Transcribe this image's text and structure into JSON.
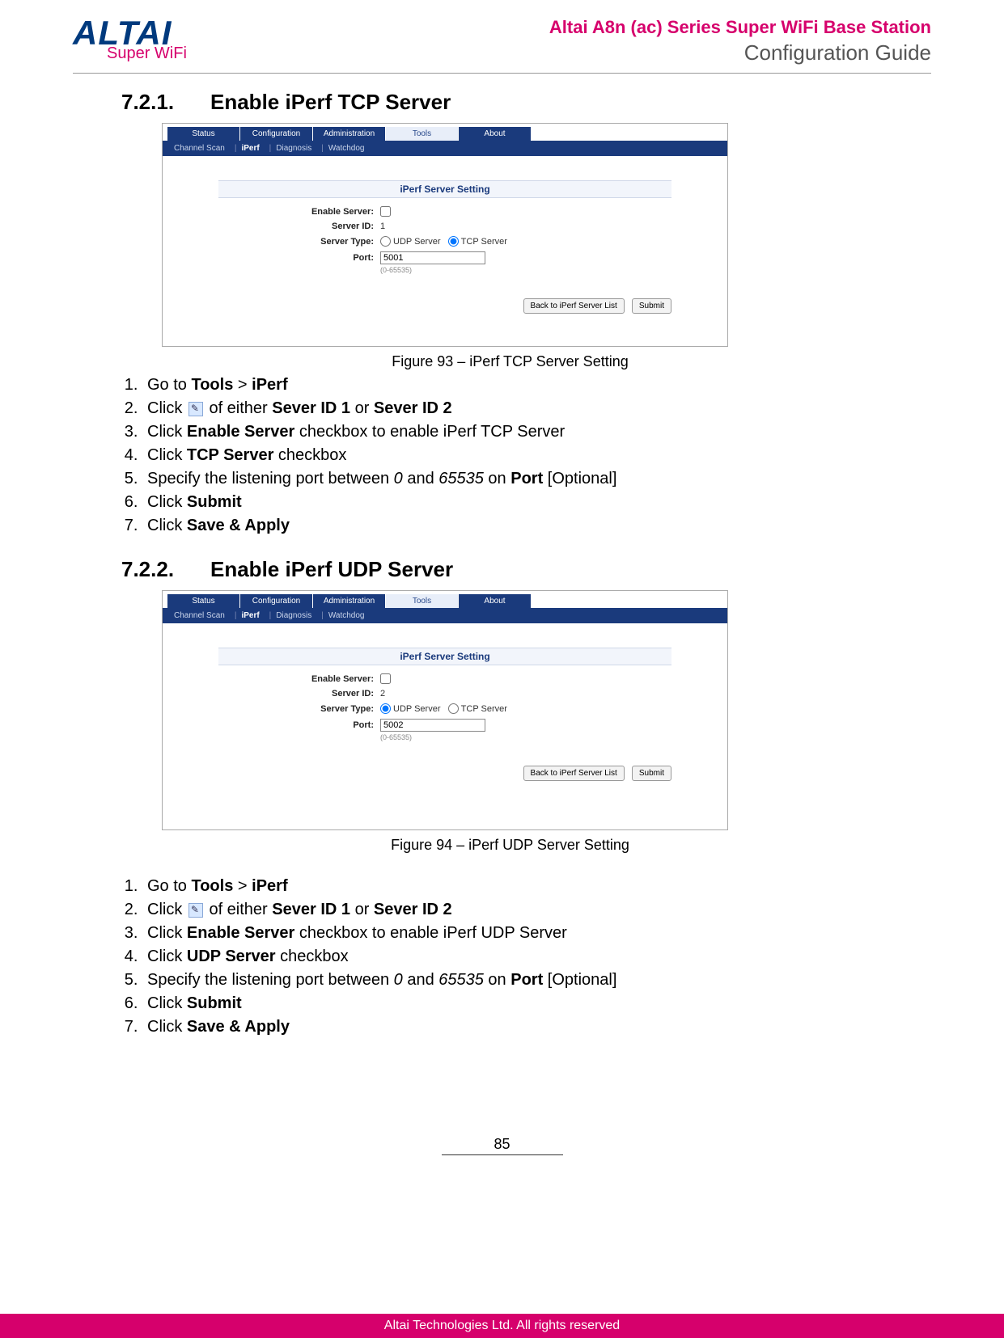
{
  "header": {
    "logo_main": "ALTAI",
    "logo_sub": "Super WiFi",
    "line1": "Altai A8n (ac) Series Super WiFi Base Station",
    "line2": "Configuration Guide"
  },
  "section1": {
    "number": "7.2.1.",
    "title": "Enable iPerf TCP Server",
    "figure_caption": "Figure 93 – iPerf TCP Server Setting",
    "ui": {
      "tabs": [
        "Status",
        "Configuration",
        "Administration",
        "Tools",
        "About"
      ],
      "active_tab_index": 3,
      "subtabs": [
        "Channel Scan",
        "iPerf",
        "Diagnosis",
        "Watchdog"
      ],
      "active_subtab_index": 1,
      "panel_title": "iPerf Server Setting",
      "enable_label": "Enable Server:",
      "enable_checked": false,
      "serverid_label": "Server ID:",
      "serverid_value": "1",
      "servertype_label": "Server Type:",
      "udp_label": "UDP Server",
      "tcp_label": "TCP Server",
      "udp_checked": false,
      "tcp_checked": true,
      "port_label": "Port:",
      "port_value": "5001",
      "port_hint": "(0-65535)",
      "btn_back": "Back to iPerf Server List",
      "btn_submit": "Submit"
    },
    "steps": [
      {
        "pre": "Go to ",
        "b1": "Tools",
        "mid1": " > ",
        "b2": "iPerf"
      },
      {
        "pre": "Click ",
        "icon": true,
        "mid1": " of either ",
        "b1": "Sever ID 1",
        "mid2": " or ",
        "b2": "Sever ID 2"
      },
      {
        "pre": "Click ",
        "b1": "Enable Server",
        "mid1": " checkbox to enable iPerf TCP Server"
      },
      {
        "pre": "Click ",
        "b1": "TCP Server",
        "mid1": " checkbox"
      },
      {
        "pre": "Specify the listening port between ",
        "i1": "0",
        "mid1": " and ",
        "i2": "65535",
        "mid2": " on ",
        "b1": "Port",
        "mid3": " [Optional]"
      },
      {
        "pre": "Click ",
        "b1": "Submit"
      },
      {
        "pre": "Click ",
        "b1": "Save & Apply"
      }
    ]
  },
  "section2": {
    "number": "7.2.2.",
    "title": "Enable iPerf UDP Server",
    "figure_caption": "Figure 94 – iPerf UDP Server Setting",
    "ui": {
      "tabs": [
        "Status",
        "Configuration",
        "Administration",
        "Tools",
        "About"
      ],
      "active_tab_index": 3,
      "subtabs": [
        "Channel Scan",
        "iPerf",
        "Diagnosis",
        "Watchdog"
      ],
      "active_subtab_index": 1,
      "panel_title": "iPerf Server Setting",
      "enable_label": "Enable Server:",
      "enable_checked": false,
      "serverid_label": "Server ID:",
      "serverid_value": "2",
      "servertype_label": "Server Type:",
      "udp_label": "UDP Server",
      "tcp_label": "TCP Server",
      "udp_checked": true,
      "tcp_checked": false,
      "port_label": "Port:",
      "port_value": "5002",
      "port_hint": "(0-65535)",
      "btn_back": "Back to iPerf Server List",
      "btn_submit": "Submit"
    },
    "steps": [
      {
        "pre": "Go to ",
        "b1": "Tools",
        "mid1": " > ",
        "b2": "iPerf"
      },
      {
        "pre": "Click ",
        "icon": true,
        "mid1": " of either ",
        "b1": "Sever ID 1",
        "mid2": " or ",
        "b2": "Sever ID 2"
      },
      {
        "pre": "Click ",
        "b1": "Enable Server",
        "mid1": " checkbox to enable iPerf UDP Server"
      },
      {
        "pre": "Click ",
        "b1": "UDP Server",
        "mid1": " checkbox"
      },
      {
        "pre": "Specify the listening port between ",
        "i1": "0",
        "mid1": " and ",
        "i2": "65535",
        "mid2": " on ",
        "b1": "Port",
        "mid3": " [Optional]"
      },
      {
        "pre": "Click ",
        "b1": "Submit"
      },
      {
        "pre": "Click ",
        "b1": "Save & Apply"
      }
    ]
  },
  "page_number": "85",
  "footer": "Altai Technologies Ltd. All rights reserved"
}
